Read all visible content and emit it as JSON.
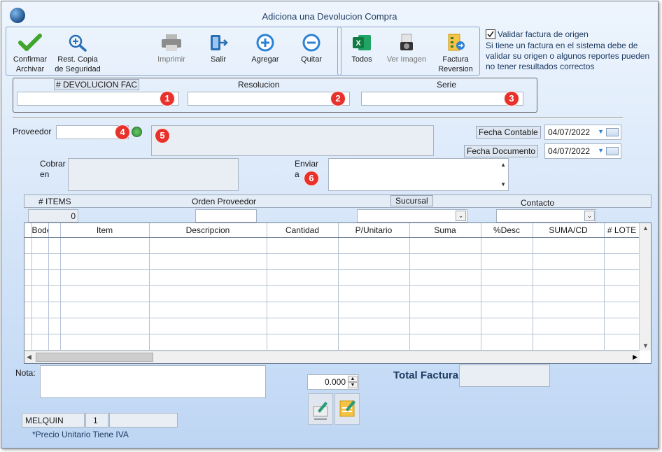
{
  "window": {
    "title": "Adiciona una Devolucion Compra"
  },
  "toolbar": {
    "confirm": "Confirmar\nArchivar",
    "restore": "Rest. Copia\nde Seguridad",
    "print": "Imprimir",
    "exit": "Salir",
    "add": "Agregar",
    "remove": "Quitar",
    "all": "Todos",
    "view_image": "Ver Imagen",
    "invoice_reversal": "Factura\nReversion"
  },
  "validate": {
    "checkbox_label": "Validar factura de origen",
    "checked": true,
    "note": "Si tiene un factura en el sistema debe de validar su origen o algunos reportes pueden no tener resultados correctos"
  },
  "header_fields": {
    "devolucion_label": "# DEVOLUCION FAC",
    "resolucion_label": "Resolucion",
    "serie_label": "Serie",
    "devolucion_value": "",
    "resolucion_value": "",
    "serie_value": ""
  },
  "badges": [
    "1",
    "2",
    "3",
    "4",
    "5",
    "6"
  ],
  "supplier": {
    "proveedor_label": "Proveedor",
    "proveedor_value": "",
    "cobrar_label": "Cobrar\nen",
    "enviar_label": "Enviar\na",
    "fecha_contable_label": "Fecha Contable",
    "fecha_contable_value": "04/07/2022",
    "fecha_documento_label": "Fecha Documento",
    "fecha_documento_value": "04/07/2022"
  },
  "summary": {
    "items_label": "# ITEMS",
    "items_value": "0",
    "orden_label": "Orden Proveedor",
    "sucursal_label": "Sucursal",
    "contacto_label": "Contacto"
  },
  "grid": {
    "columns": [
      "",
      "Bodega",
      "",
      "Item",
      "Descripcion",
      "Cantidad",
      "P/Unitario",
      "Suma",
      "%Desc",
      "SUMA/CD",
      "# LOTE"
    ],
    "row_count": 7
  },
  "footer": {
    "nota_label": "Nota:",
    "nota_value": "",
    "spinner_value": "0.000",
    "total_label": "Total Factura",
    "total_value": "",
    "user": "MELQUIN",
    "user_num": "1",
    "user_extra": "",
    "footnote": "*Precio Unitario Tiene IVA"
  },
  "colors": {
    "accent": "#1f3c63",
    "badge": "#e8312a",
    "total_label": "#1f3c63"
  }
}
